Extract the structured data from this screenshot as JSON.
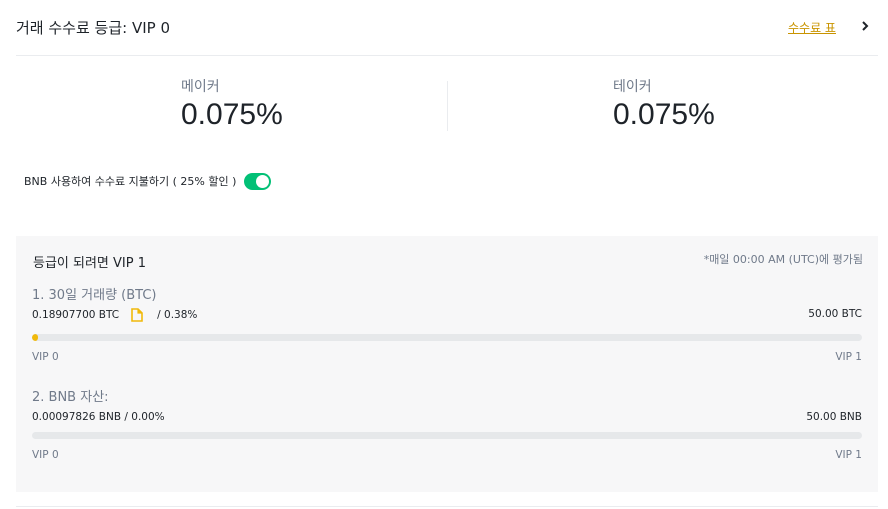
{
  "header": {
    "title": "거래 수수료 등급: VIP 0",
    "fee_schedule_link": "수수료 표",
    "chevron_icon": "chevron-right-icon"
  },
  "rates": {
    "maker_label": "메이커",
    "maker_value": "0.075%",
    "taker_label": "테이커",
    "taker_value": "0.075%"
  },
  "bnb_option": {
    "label": "BNB 사용하여 수수료 지불하기 ( 25% 할인 )",
    "enabled": true,
    "toggle_color": "#02c076"
  },
  "progress": {
    "title": "등급이 되려면 VIP 1",
    "note": "*매일 00:00 AM (UTC)에 평가됨",
    "volume": {
      "title": "1. 30일 거래량 (BTC)",
      "current": "0.18907700 BTC",
      "percent_text": "/ 0.38%",
      "percent": 0.38,
      "target": "50.00 BTC",
      "from_level": "VIP 0",
      "to_level": "VIP 1",
      "icon": "document-icon"
    },
    "bnb_assets": {
      "title": "2. BNB 자산:",
      "current": "0.00097826 BNB / 0.00%",
      "percent": 0.0,
      "target": "50.00 BNB",
      "from_level": "VIP 0",
      "to_level": "VIP 1"
    },
    "accent_color": "#f0b90b"
  }
}
